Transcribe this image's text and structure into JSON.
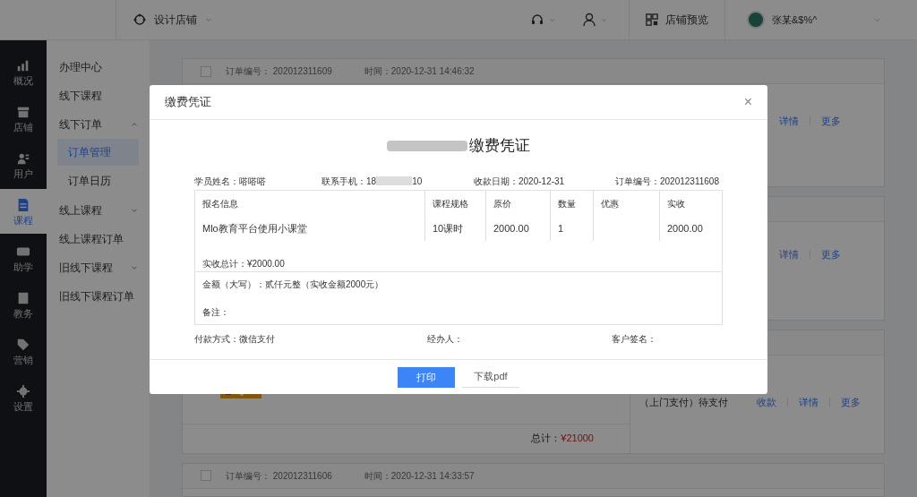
{
  "topbar": {
    "shop": "设计店铺",
    "preview": "店铺预览",
    "user": "张某&$%^"
  },
  "nav": [
    {
      "label": "概况",
      "selected": false
    },
    {
      "label": "店铺",
      "selected": false
    },
    {
      "label": "用户",
      "selected": false
    },
    {
      "label": "课程",
      "selected": true
    },
    {
      "label": "助学",
      "selected": false
    },
    {
      "label": "教务",
      "selected": false
    },
    {
      "label": "营销",
      "selected": false
    },
    {
      "label": "设置",
      "selected": false
    }
  ],
  "subnav": [
    {
      "label": "办理中心"
    },
    {
      "label": "线下课程"
    },
    {
      "label": "线下订单",
      "expanded": true,
      "children": [
        {
          "label": "订单管理",
          "selected": true
        },
        {
          "label": "订单日历",
          "selected": false
        }
      ]
    },
    {
      "label": "线上课程",
      "expanded": false
    },
    {
      "label": "线上课程订单"
    },
    {
      "label": "旧线下课程",
      "expanded": false
    },
    {
      "label": "旧线下课程订单"
    }
  ],
  "orders": [
    {
      "checked": false,
      "number_label": "订单编号：",
      "number": "202012311609",
      "time": "时间：2020-12-31 14:46:32"
    },
    {
      "checked": false,
      "number_label": "订单编号：",
      "number": "202012311606",
      "time": "时间：2020-12-31 14:33:57"
    }
  ],
  "row_actions": [
    {
      "links": [
        "详情",
        "更多"
      ]
    },
    {
      "links": [
        "详情",
        "更多"
      ]
    },
    {
      "status": "（上门支付）待支付",
      "links": [
        "收款",
        "详情",
        "更多"
      ]
    }
  ],
  "total": {
    "label": "总计：",
    "value": "¥21000"
  },
  "dialog": {
    "title": "缴费凭证",
    "close": "×",
    "heading": "缴费凭证",
    "student": "学员姓名：嗒嗒嗒",
    "phone_label": "联系手机：18",
    "phone_end": "10",
    "date": "收款日期：2020-12-31",
    "order_no": "订单编号：202012311608",
    "columns": [
      {
        "header": "报名信息",
        "value": "Mlo教育平台使用小课堂"
      },
      {
        "header": "课程规格",
        "value": "10课时"
      },
      {
        "header": "原价",
        "value": "2000.00"
      },
      {
        "header": "数量",
        "value": "1"
      },
      {
        "header": "优惠"
      },
      {
        "header": "实收",
        "value": "2000.00"
      }
    ],
    "sum": "实收总计：¥2000.00",
    "amount": "金额（大写）：贰仟元整（实收金额2000元）",
    "remark": "备注：",
    "payment": "付款方式：微信支付",
    "handler": "经办人：",
    "signature": "客户签名：",
    "buttons": [
      {
        "label": "打印",
        "kind": "primary"
      },
      {
        "label": "下载pdf",
        "kind": "plain"
      }
    ]
  }
}
